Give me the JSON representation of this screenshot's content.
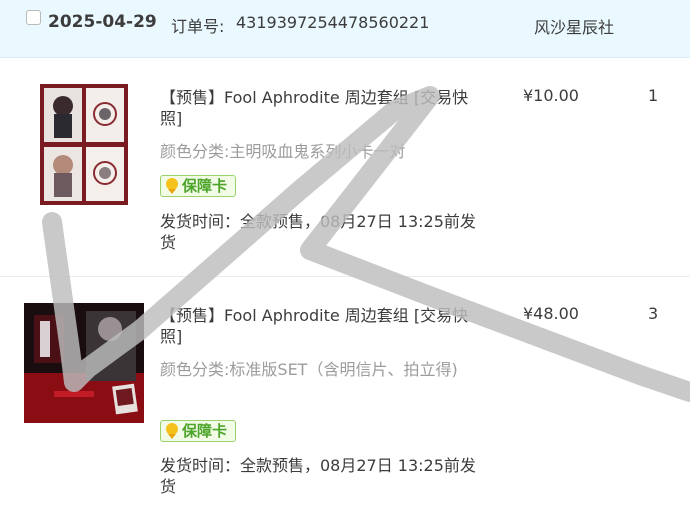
{
  "order": {
    "date": "2025-04-29",
    "order_no_label": "订单号:",
    "order_no": "4319397254478560221",
    "shop": "风沙星辰社"
  },
  "items": [
    {
      "title": "【预售】Fool Aphrodite 周边套组 [交易快照]",
      "spec_label": "颜色分类:",
      "spec_value": "主明吸血鬼系列小卡一对",
      "badge": "保障卡",
      "ship": "发货时间：全款预售，08月27日 13:25前发货",
      "price": "¥10.00",
      "qty": "1"
    },
    {
      "title": "【预售】Fool Aphrodite 周边套组 [交易快照]",
      "spec_label": "颜色分类:",
      "spec_value": "标准版SET（含明信片、拍立得)",
      "badge": "保障卡",
      "ship": "发货时间：全款预售，08月27日 13:25前发货",
      "price": "¥48.00",
      "qty": "3"
    }
  ],
  "colors": {
    "header_bg": "#eaf8ff",
    "badge_green": "#4da52a",
    "scribble": "#bdbdbd"
  }
}
